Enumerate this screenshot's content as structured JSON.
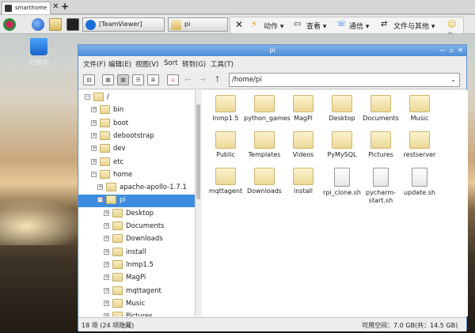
{
  "browser": {
    "tab_title": "smarthome"
  },
  "taskbar": {
    "btn_teamviewer": "[TeamViewer]",
    "btn_pi": "pi"
  },
  "teamviewer_toolbar": {
    "actions": "动作",
    "view": "查看",
    "comm": "通信",
    "files": "文件与其他"
  },
  "desktop": {
    "trash_label": "回收站"
  },
  "window": {
    "title": "pi",
    "menu": [
      "文件(F)",
      "编辑(E)",
      "视图(V)",
      "Sort",
      "转到(G)",
      "工具(T)"
    ],
    "path": "/home/pi",
    "tree": [
      {
        "label": "/",
        "level": 0,
        "exp": "−"
      },
      {
        "label": "bin",
        "level": 1,
        "exp": "+"
      },
      {
        "label": "boot",
        "level": 1,
        "exp": "+"
      },
      {
        "label": "debootstrap",
        "level": 1,
        "exp": "+"
      },
      {
        "label": "dev",
        "level": 1,
        "exp": "+"
      },
      {
        "label": "etc",
        "level": 1,
        "exp": "+"
      },
      {
        "label": "home",
        "level": 1,
        "exp": "−"
      },
      {
        "label": "apache-apollo-1.7.1",
        "level": 2,
        "exp": "+"
      },
      {
        "label": "pi",
        "level": 2,
        "exp": "−",
        "selected": true
      },
      {
        "label": "Desktop",
        "level": 3,
        "exp": "+"
      },
      {
        "label": "Documents",
        "level": 3,
        "exp": "+"
      },
      {
        "label": "Downloads",
        "level": 3,
        "exp": "+"
      },
      {
        "label": "install",
        "level": 3,
        "exp": "+"
      },
      {
        "label": "lnmp1.5",
        "level": 3,
        "exp": "+"
      },
      {
        "label": "MagPi",
        "level": 3,
        "exp": "+"
      },
      {
        "label": "mqttagent",
        "level": 3,
        "exp": "+"
      },
      {
        "label": "Music",
        "level": 3,
        "exp": "+"
      },
      {
        "label": "Pictures",
        "level": 3,
        "exp": "+"
      }
    ],
    "files": [
      {
        "label": "lnmp1.5",
        "kind": "folder"
      },
      {
        "label": "python_games",
        "kind": "folder"
      },
      {
        "label": "MagPi",
        "kind": "folder"
      },
      {
        "label": "Desktop",
        "kind": "folder"
      },
      {
        "label": "Documents",
        "kind": "folder"
      },
      {
        "label": "Music",
        "kind": "folder"
      },
      {
        "label": "Public",
        "kind": "folder"
      },
      {
        "label": "Templates",
        "kind": "folder"
      },
      {
        "label": "Videos",
        "kind": "folder"
      },
      {
        "label": "PyMySQL",
        "kind": "folder"
      },
      {
        "label": "Pictures",
        "kind": "folder"
      },
      {
        "label": "restserver",
        "kind": "folder"
      },
      {
        "label": "mqttagent",
        "kind": "folder"
      },
      {
        "label": "Downloads",
        "kind": "folder"
      },
      {
        "label": "install",
        "kind": "folder"
      },
      {
        "label": "rpi_clone.sh",
        "kind": "script"
      },
      {
        "label": "pycharm-start.sh",
        "kind": "script"
      },
      {
        "label": "update.sh",
        "kind": "script"
      }
    ],
    "status_left": "18 项 (24 项隐藏)",
    "status_right": "可用空间：7.0 GB(共：14.5 GB)"
  }
}
